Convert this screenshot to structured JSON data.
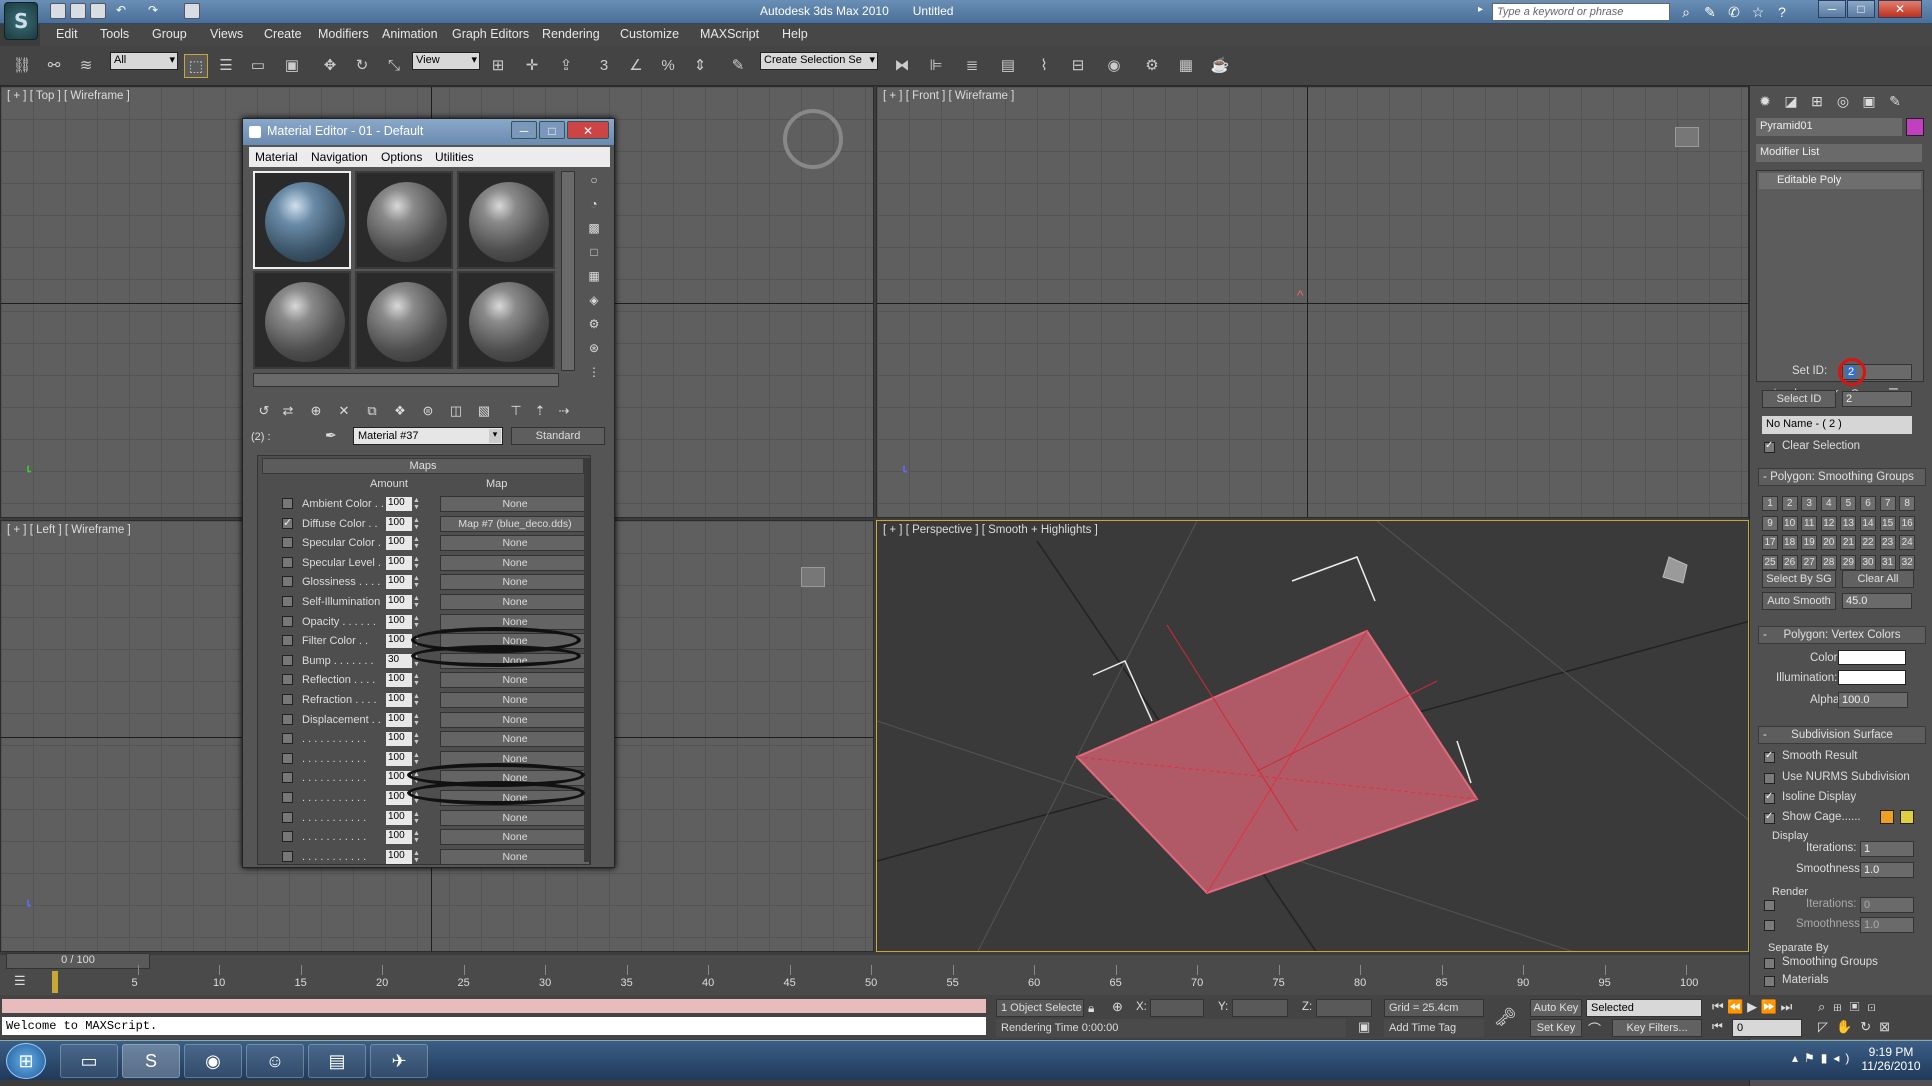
{
  "app": {
    "title": "Autodesk 3ds Max 2010",
    "file": "Untitled",
    "search_placeholder": "Type a keyword or phrase"
  },
  "menu": [
    "Edit",
    "Tools",
    "Group",
    "Views",
    "Create",
    "Modifiers",
    "Animation",
    "Graph Editors",
    "Rendering",
    "Customize",
    "MAXScript",
    "Help"
  ],
  "toolbar": {
    "selection_filter": "All",
    "ref_coord": "View",
    "named_selection": "Create Selection Se"
  },
  "viewports": {
    "top": "[ + ] [ Top ] [ Wireframe ]",
    "front": "[ + ] [ Front ] [ Wireframe ]",
    "left": "[ + ] [ Left ] [ Wireframe ]",
    "perspective": "[ + ] [ Perspective ] [ Smooth + Highlights ]"
  },
  "material_editor": {
    "title": "Material Editor - 01 - Default",
    "menu": [
      "Material",
      "Navigation",
      "Options",
      "Utilities"
    ],
    "slot_label": "(2) :",
    "material_name": "Material #37",
    "material_type": "Standard",
    "rollout": "Maps",
    "col_amount": "Amount",
    "col_map": "Map",
    "maps": [
      {
        "name": "Ambient Color . .",
        "amount": "100",
        "map": "None",
        "checked": false
      },
      {
        "name": "Diffuse Color . .",
        "amount": "100",
        "map": "Map #7 (blue_deco.dds)",
        "checked": true
      },
      {
        "name": "Specular Color .",
        "amount": "100",
        "map": "None",
        "checked": false
      },
      {
        "name": "Specular Level .",
        "amount": "100",
        "map": "None",
        "checked": false
      },
      {
        "name": "Glossiness . . . .",
        "amount": "100",
        "map": "None",
        "checked": false
      },
      {
        "name": "Self-Illumination",
        "amount": "100",
        "map": "None",
        "checked": false
      },
      {
        "name": "Opacity . . . . . .",
        "amount": "100",
        "map": "None",
        "checked": false
      },
      {
        "name": "Filter Color . .",
        "amount": "100",
        "map": "None",
        "checked": false
      },
      {
        "name": "Bump . . . . . . .",
        "amount": "30",
        "map": "None",
        "checked": false
      },
      {
        "name": "Reflection . . . .",
        "amount": "100",
        "map": "None",
        "checked": false
      },
      {
        "name": "Refraction . . . .",
        "amount": "100",
        "map": "None",
        "checked": false
      },
      {
        "name": "Displacement . .",
        "amount": "100",
        "map": "None",
        "checked": false
      },
      {
        "name": ". . . . . . . . . . .",
        "amount": "100",
        "map": "None",
        "checked": false
      },
      {
        "name": ". . . . . . . . . . .",
        "amount": "100",
        "map": "None",
        "checked": false
      },
      {
        "name": ". . . . . . . . . . .",
        "amount": "100",
        "map": "None",
        "checked": false
      },
      {
        "name": ". . . . . . . . . . .",
        "amount": "100",
        "map": "None",
        "checked": false
      },
      {
        "name": ". . . . . . . . . . .",
        "amount": "100",
        "map": "None",
        "checked": false
      },
      {
        "name": ". . . . . . . . . . .",
        "amount": "100",
        "map": "None",
        "checked": false
      },
      {
        "name": ". . . . . . . . . . .",
        "amount": "100",
        "map": "None",
        "checked": false
      }
    ]
  },
  "command_panel": {
    "object_name": "Pyramid01",
    "object_color": "#c040c0",
    "modifier_list": "Modifier List",
    "stack_item": "Editable Poly",
    "set_id_label": "Set ID:",
    "set_id_value": "2",
    "select_id_label": "Select ID",
    "select_id_value": "2",
    "name_dropdown": "No Name - ( 2 )",
    "clear_selection": "Clear Selection",
    "smoothing_title": "Polygon: Smoothing Groups",
    "smoothing_groups": [
      "1",
      "2",
      "3",
      "4",
      "5",
      "6",
      "7",
      "8",
      "9",
      "10",
      "11",
      "12",
      "13",
      "14",
      "15",
      "16",
      "17",
      "18",
      "19",
      "20",
      "21",
      "22",
      "23",
      "24",
      "25",
      "26",
      "27",
      "28",
      "29",
      "30",
      "31",
      "32"
    ],
    "select_by_sg": "Select By SG",
    "clear_all": "Clear All",
    "auto_smooth": "Auto Smooth",
    "auto_smooth_value": "45.0",
    "vertex_colors_title": "Polygon: Vertex Colors",
    "color_label": "Color:",
    "illum_label": "Illumination:",
    "alpha_label": "Alpha:",
    "alpha_value": "100.0",
    "subdiv_title": "Subdivision Surface",
    "smooth_result": "Smooth Result",
    "use_nurms": "Use NURMS Subdivision",
    "isoline": "Isoline Display",
    "show_cage": "Show Cage......",
    "display_label": "Display",
    "iterations_label": "Iterations:",
    "iterations_value": "1",
    "smoothness_label": "Smoothness:",
    "smoothness_value": "1.0",
    "render_label": "Render",
    "r_iterations_value": "0",
    "r_smoothness_value": "1.0",
    "separate_by": "Separate By",
    "smoothing_groups_cb": "Smoothing Groups",
    "materials_cb": "Materials",
    "cage_color1": "#f0a020",
    "cage_color2": "#e0d040"
  },
  "timeline": {
    "frame": "0 / 100",
    "ticks": [
      "5",
      "10",
      "15",
      "20",
      "25",
      "30",
      "35",
      "40",
      "45",
      "50",
      "55",
      "60",
      "65",
      "70",
      "75",
      "80",
      "85",
      "90",
      "95",
      "100"
    ]
  },
  "status": {
    "maxscript": "Welcome to MAXScript.",
    "selection": "1 Object Selecte",
    "x_label": "X:",
    "y_label": "Y:",
    "z_label": "Z:",
    "grid": "Grid = 25.4cm",
    "rendering_time": "Rendering Time  0:00:00",
    "add_time_tag": "Add Time Tag",
    "auto_key": "Auto Key",
    "set_key": "Set Key",
    "key_mode": "Selected",
    "key_filters": "Key Filters...",
    "frame_field": "0"
  },
  "taskbar": {
    "time": "9:19 PM",
    "date": "11/26/2010"
  }
}
